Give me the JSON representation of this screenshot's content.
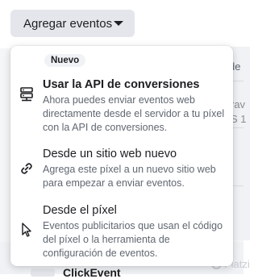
{
  "trigger": {
    "label": "Agregar eventos",
    "icon": "caret-down-icon"
  },
  "menu": {
    "badge": "Nuevo",
    "items": [
      {
        "title": "Usar la API de conversiones",
        "description": "Ahora puedes enviar eventos web directamente desde el servidor a tu píxel con la API de conversiones.",
        "icon": "server-icon"
      },
      {
        "title": "Desde un sitio web nuevo",
        "description": "Agrega este píxel a un nuevo sitio web para empezar a enviar eventos.",
        "icon": "link-icon"
      },
      {
        "title": "Desde el píxel",
        "description": "Eventos publicitarios que usan el código del píxel o la herramienta de configuración de eventos.",
        "icon": "cursor-icon"
      }
    ]
  },
  "background": {
    "fragment_1": "de",
    "fragment_2": "rav",
    "fragment_3": "S 1",
    "peek_label": "ClickEvent",
    "watermark": "Platzi"
  },
  "colors": {
    "trigger_bg": "#e4e6eb",
    "text_primary": "#1c1e21",
    "text_secondary": "#606770",
    "menu_bg": "#ffffff"
  }
}
